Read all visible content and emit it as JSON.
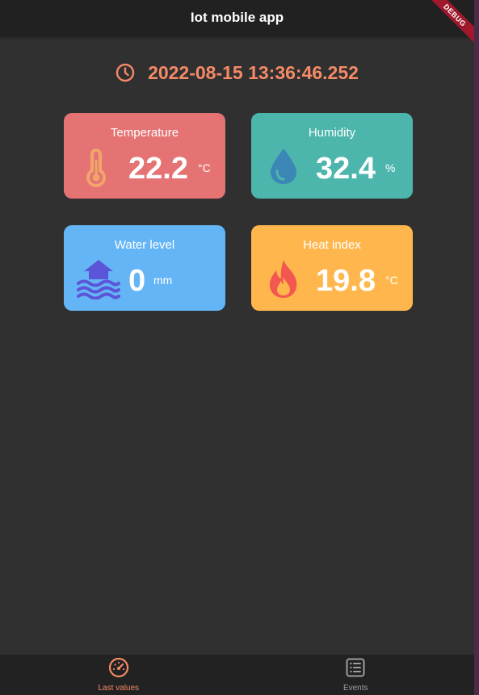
{
  "app": {
    "title": "Iot mobile app",
    "debug_banner": "DEBUG"
  },
  "header": {
    "timestamp": "2022-08-15 13:36:46.252",
    "clock_icon": "clock-icon"
  },
  "colors": {
    "accent": "#f58a66",
    "temperature_card": "#e57373",
    "humidity_card": "#4db6ac",
    "water_level_card": "#64b5f6",
    "heat_index_card": "#ffb74d",
    "background": "#303030",
    "appbar": "#212121",
    "nav_inactive": "#9e9e9e"
  },
  "cards": {
    "temperature": {
      "title": "Temperature",
      "value": "22.2",
      "unit": "°C",
      "icon": "thermometer-icon"
    },
    "humidity": {
      "title": "Humidity",
      "value": "32.4",
      "unit": "%",
      "icon": "water-drop-icon"
    },
    "water_level": {
      "title": "Water level",
      "value": "0",
      "unit": "mm",
      "icon": "house-flood-icon"
    },
    "heat_index": {
      "title": "Heat index",
      "value": "19.8",
      "unit": "°C",
      "icon": "flame-icon"
    }
  },
  "bottom_nav": {
    "items": [
      {
        "label": "Last values",
        "icon": "gauge-icon",
        "active": true
      },
      {
        "label": "Events",
        "icon": "list-icon",
        "active": false
      }
    ]
  }
}
